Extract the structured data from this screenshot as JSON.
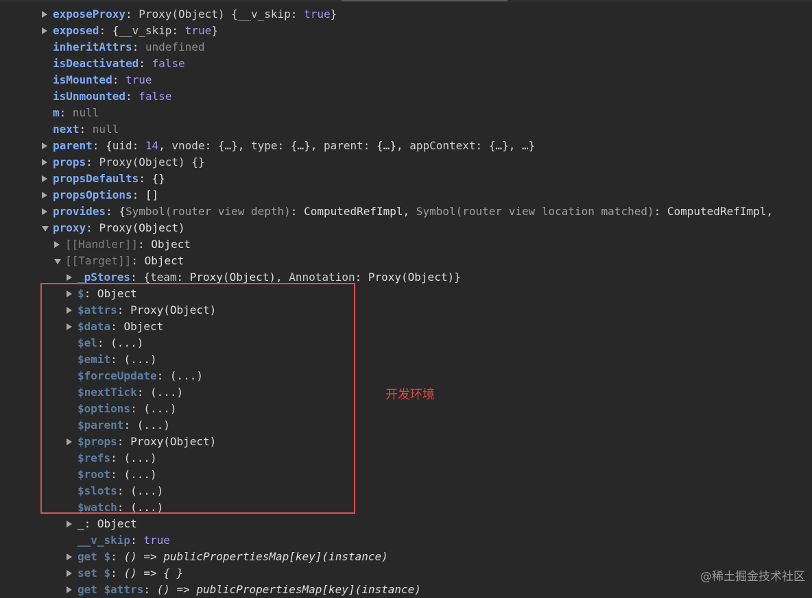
{
  "colors": {
    "background": "#282828",
    "key": "#7cacf8",
    "dim_key": "#5d7ea3",
    "keyword": "#a796f2",
    "highlight_box": "#d9534f",
    "annotation": "#e0453c"
  },
  "rows": [
    {
      "name": "row-exposeproxy",
      "indent": 0,
      "toggle": "collapsed",
      "parts": [
        {
          "t": "exposeProxy",
          "c": "k"
        },
        {
          "t": ": ",
          "c": "p"
        },
        {
          "t": "Proxy(Object) {",
          "c": "d"
        },
        {
          "t": "__v_skip",
          "c": "d"
        },
        {
          "t": ": ",
          "c": "p"
        },
        {
          "t": "true",
          "c": "kw"
        },
        {
          "t": "}",
          "c": "d"
        }
      ]
    },
    {
      "name": "row-exposed",
      "indent": 0,
      "toggle": "collapsed",
      "parts": [
        {
          "t": "exposed",
          "c": "k"
        },
        {
          "t": ": {",
          "c": "p"
        },
        {
          "t": "__v_skip",
          "c": "d"
        },
        {
          "t": ": ",
          "c": "p"
        },
        {
          "t": "true",
          "c": "kw"
        },
        {
          "t": "}",
          "c": "p"
        }
      ]
    },
    {
      "name": "row-inheritattrs",
      "indent": 0,
      "toggle": "none",
      "parts": [
        {
          "t": "inheritAttrs",
          "c": "k"
        },
        {
          "t": ": ",
          "c": "p"
        },
        {
          "t": "undefined",
          "c": "nul"
        }
      ]
    },
    {
      "name": "row-isdeactivated",
      "indent": 0,
      "toggle": "none",
      "parts": [
        {
          "t": "isDeactivated",
          "c": "k"
        },
        {
          "t": ": ",
          "c": "p"
        },
        {
          "t": "false",
          "c": "kw"
        }
      ]
    },
    {
      "name": "row-ismounted",
      "indent": 0,
      "toggle": "none",
      "parts": [
        {
          "t": "isMounted",
          "c": "k"
        },
        {
          "t": ": ",
          "c": "p"
        },
        {
          "t": "true",
          "c": "kw"
        }
      ]
    },
    {
      "name": "row-isunmounted",
      "indent": 0,
      "toggle": "none",
      "parts": [
        {
          "t": "isUnmounted",
          "c": "k"
        },
        {
          "t": ": ",
          "c": "p"
        },
        {
          "t": "false",
          "c": "kw"
        }
      ]
    },
    {
      "name": "row-m",
      "indent": 0,
      "toggle": "none",
      "parts": [
        {
          "t": "m",
          "c": "k"
        },
        {
          "t": ": ",
          "c": "p"
        },
        {
          "t": "null",
          "c": "nul"
        }
      ]
    },
    {
      "name": "row-next",
      "indent": 0,
      "toggle": "none",
      "parts": [
        {
          "t": "next",
          "c": "k"
        },
        {
          "t": ": ",
          "c": "p"
        },
        {
          "t": "null",
          "c": "nul"
        }
      ]
    },
    {
      "name": "row-parent",
      "indent": 0,
      "toggle": "collapsed",
      "parts": [
        {
          "t": "parent",
          "c": "k"
        },
        {
          "t": ": {",
          "c": "p"
        },
        {
          "t": "uid",
          "c": "d"
        },
        {
          "t": ": ",
          "c": "p"
        },
        {
          "t": "14",
          "c": "num"
        },
        {
          "t": ", ",
          "c": "p"
        },
        {
          "t": "vnode",
          "c": "d"
        },
        {
          "t": ": {…}, ",
          "c": "p"
        },
        {
          "t": "type",
          "c": "d"
        },
        {
          "t": ": {…}, ",
          "c": "p"
        },
        {
          "t": "parent",
          "c": "d"
        },
        {
          "t": ": {…}, ",
          "c": "p"
        },
        {
          "t": "appContext",
          "c": "d"
        },
        {
          "t": ": {…}, …}",
          "c": "p"
        }
      ]
    },
    {
      "name": "row-props",
      "indent": 0,
      "toggle": "collapsed",
      "parts": [
        {
          "t": "props",
          "c": "k"
        },
        {
          "t": ": ",
          "c": "p"
        },
        {
          "t": "Proxy(Object) {}",
          "c": "d"
        }
      ]
    },
    {
      "name": "row-propsdefaults",
      "indent": 0,
      "toggle": "collapsed",
      "parts": [
        {
          "t": "propsDefaults",
          "c": "k"
        },
        {
          "t": ": {}",
          "c": "p"
        }
      ]
    },
    {
      "name": "row-propsoptions",
      "indent": 0,
      "toggle": "collapsed",
      "parts": [
        {
          "t": "propsOptions",
          "c": "k"
        },
        {
          "t": ": []",
          "c": "p"
        }
      ]
    },
    {
      "name": "row-provides",
      "indent": 0,
      "toggle": "collapsed",
      "parts": [
        {
          "t": "provides",
          "c": "k"
        },
        {
          "t": ": {",
          "c": "p"
        },
        {
          "t": "Symbol(router view depth)",
          "c": "dim"
        },
        {
          "t": ": ComputedRefImpl, ",
          "c": "p"
        },
        {
          "t": "Symbol(router view location matched)",
          "c": "dim"
        },
        {
          "t": ": ComputedRefImpl,",
          "c": "p"
        }
      ]
    },
    {
      "name": "row-proxy",
      "indent": 0,
      "toggle": "expanded",
      "parts": [
        {
          "t": "proxy",
          "c": "k"
        },
        {
          "t": ": Proxy(Object)",
          "c": "p"
        }
      ]
    },
    {
      "name": "row-handler",
      "indent": 1,
      "toggle": "collapsed",
      "parts": [
        {
          "t": "[[Handler]]",
          "c": "kg"
        },
        {
          "t": ": Object",
          "c": "p"
        }
      ]
    },
    {
      "name": "row-target",
      "indent": 1,
      "toggle": "expanded",
      "parts": [
        {
          "t": "[[Target]]",
          "c": "kg"
        },
        {
          "t": ": Object",
          "c": "p"
        }
      ]
    },
    {
      "name": "row-pstores",
      "indent": 2,
      "toggle": "collapsed",
      "parts": [
        {
          "t": "_pStores",
          "c": "k"
        },
        {
          "t": ": {",
          "c": "p"
        },
        {
          "t": "team",
          "c": "d"
        },
        {
          "t": ": Proxy(Object), ",
          "c": "p"
        },
        {
          "t": "Annotation",
          "c": "d"
        },
        {
          "t": ": Proxy(Object)}",
          "c": "p"
        }
      ]
    },
    {
      "name": "row-dollar",
      "indent": 2,
      "toggle": "collapsed",
      "parts": [
        {
          "t": "$",
          "c": "kd"
        },
        {
          "t": ": Object",
          "c": "p"
        }
      ]
    },
    {
      "name": "row-attrs",
      "indent": 2,
      "toggle": "collapsed",
      "parts": [
        {
          "t": "$attrs",
          "c": "kd"
        },
        {
          "t": ": Proxy(Object)",
          "c": "p"
        }
      ]
    },
    {
      "name": "row-data",
      "indent": 2,
      "toggle": "collapsed",
      "parts": [
        {
          "t": "$data",
          "c": "kd"
        },
        {
          "t": ": Object",
          "c": "p"
        }
      ]
    },
    {
      "name": "row-el",
      "indent": 2,
      "toggle": "none",
      "parts": [
        {
          "t": "$el",
          "c": "kd"
        },
        {
          "t": ": (...)",
          "c": "p"
        }
      ]
    },
    {
      "name": "row-emit",
      "indent": 2,
      "toggle": "none",
      "parts": [
        {
          "t": "$emit",
          "c": "kd"
        },
        {
          "t": ": (...)",
          "c": "p"
        }
      ]
    },
    {
      "name": "row-forceupdate",
      "indent": 2,
      "toggle": "none",
      "parts": [
        {
          "t": "$forceUpdate",
          "c": "kd"
        },
        {
          "t": ": (...)",
          "c": "p"
        }
      ]
    },
    {
      "name": "row-nexttick",
      "indent": 2,
      "toggle": "none",
      "parts": [
        {
          "t": "$nextTick",
          "c": "kd"
        },
        {
          "t": ": (...)",
          "c": "p"
        }
      ]
    },
    {
      "name": "row-options",
      "indent": 2,
      "toggle": "none",
      "parts": [
        {
          "t": "$options",
          "c": "kd"
        },
        {
          "t": ": (...)",
          "c": "p"
        }
      ]
    },
    {
      "name": "row-dollar-parent",
      "indent": 2,
      "toggle": "none",
      "parts": [
        {
          "t": "$parent",
          "c": "kd"
        },
        {
          "t": ": (...)",
          "c": "p"
        }
      ]
    },
    {
      "name": "row-dollar-props",
      "indent": 2,
      "toggle": "collapsed",
      "parts": [
        {
          "t": "$props",
          "c": "kd"
        },
        {
          "t": ": Proxy(Object)",
          "c": "p"
        }
      ]
    },
    {
      "name": "row-refs",
      "indent": 2,
      "toggle": "none",
      "parts": [
        {
          "t": "$refs",
          "c": "kd"
        },
        {
          "t": ": (...)",
          "c": "p"
        }
      ]
    },
    {
      "name": "row-root",
      "indent": 2,
      "toggle": "none",
      "parts": [
        {
          "t": "$root",
          "c": "kd"
        },
        {
          "t": ": (...)",
          "c": "p"
        }
      ]
    },
    {
      "name": "row-slots",
      "indent": 2,
      "toggle": "none",
      "parts": [
        {
          "t": "$slots",
          "c": "kd"
        },
        {
          "t": ": (...)",
          "c": "p"
        }
      ]
    },
    {
      "name": "row-watch",
      "indent": 2,
      "toggle": "none",
      "parts": [
        {
          "t": "$watch",
          "c": "kd"
        },
        {
          "t": ": (...)",
          "c": "p"
        }
      ]
    },
    {
      "name": "row-underscore",
      "indent": 2,
      "toggle": "collapsed",
      "parts": [
        {
          "t": "_",
          "c": "k"
        },
        {
          "t": ": Object",
          "c": "p"
        }
      ]
    },
    {
      "name": "row-vskip",
      "indent": 2,
      "toggle": "none",
      "parts": [
        {
          "t": "__v_skip",
          "c": "kd"
        },
        {
          "t": ": ",
          "c": "p"
        },
        {
          "t": "true",
          "c": "kw"
        }
      ]
    },
    {
      "name": "row-get-dollar",
      "indent": 2,
      "toggle": "collapsed",
      "parts": [
        {
          "t": "get $",
          "c": "kd"
        },
        {
          "t": ": ",
          "c": "p"
        },
        {
          "t": "() => publicPropertiesMap[key](instance)",
          "c": "it"
        }
      ]
    },
    {
      "name": "row-set-dollar",
      "indent": 2,
      "toggle": "collapsed",
      "parts": [
        {
          "t": "set $",
          "c": "kd"
        },
        {
          "t": ": ",
          "c": "p"
        },
        {
          "t": "() => { }",
          "c": "it"
        }
      ]
    },
    {
      "name": "row-get-attrs",
      "indent": 2,
      "toggle": "collapsed",
      "parts": [
        {
          "t": "get $attrs",
          "c": "kd"
        },
        {
          "t": ": ",
          "c": "p"
        },
        {
          "t": "() => publicPropertiesMap[key](instance)",
          "c": "it"
        }
      ]
    }
  ],
  "annotation": "开发环境",
  "watermark": "@稀土掘金技术社区"
}
